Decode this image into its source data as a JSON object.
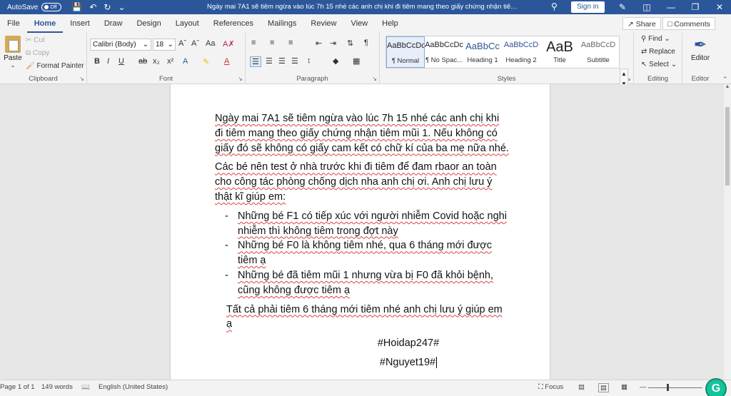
{
  "titlebar": {
    "autosave_label": "AutoSave",
    "autosave_state": "Off",
    "document_title": "Ngày mai 7A1 sẽ tiêm ngừa vào lúc 7h 15 nhé các anh chị khi đi tiêm mang theo giấy chứng nhận tiêm mũ...",
    "signin_label": "Sign in",
    "colors": {
      "bar": "#2b579a"
    }
  },
  "tabs": [
    "File",
    "Home",
    "Insert",
    "Draw",
    "Design",
    "Layout",
    "References",
    "Mailings",
    "Review",
    "View",
    "Help"
  ],
  "active_tab": "Home",
  "share_label": "Share",
  "comments_label": "Comments",
  "ribbon": {
    "clipboard": {
      "label": "Clipboard",
      "paste": "Paste",
      "cut": "Cut",
      "copy": "Copy",
      "format_painter": "Format Painter"
    },
    "font": {
      "label": "Font",
      "font_name": "Calibri (Body)",
      "font_size": "18"
    },
    "paragraph": {
      "label": "Paragraph"
    },
    "styles": {
      "label": "Styles",
      "items": [
        {
          "preview": "AaBbCcDc",
          "name": "¶ Normal"
        },
        {
          "preview": "AaBbCcDc",
          "name": "¶ No Spac..."
        },
        {
          "preview": "AaBbCc",
          "name": "Heading 1"
        },
        {
          "preview": "AaBbCcD",
          "name": "Heading 2"
        },
        {
          "preview": "AaB",
          "name": "Title"
        },
        {
          "preview": "AaBbCcD",
          "name": "Subtitle"
        }
      ]
    },
    "editing": {
      "label": "Editing",
      "find": "Find",
      "replace": "Replace",
      "select": "Select"
    },
    "editor": {
      "label": "Editor",
      "button": "Editor"
    }
  },
  "document": {
    "p1": "Ngày mai 7A1 sẽ tiêm ngừa vào lúc 7h 15 nhé các anh chị khi đi tiêm mang theo giấy chứng nhận tiêm mũi 1. Nếu không có giấy đó sẽ không có giấy cam kết có chữ kí của ba mẹ nữa nhé.",
    "p2": "Các bé nên test ở nhà trước khi đi tiêm để đam rbaor an toàn cho công tác phòng chống dịch nha anh chị ơi. Anh chị lưu ý thật kĩ giúp em:",
    "bullets": [
      "Những bé F1 có tiếp xúc với người nhiễm Covid hoặc nghi nhiễm thì không tiêm trong đợt này",
      "Những bé F0 là không tiêm nhé, qua 6 tháng mới được tiêm ạ",
      "Những bé đã tiêm mũi 1 nhưng vừa bị F0 đã khỏi bệnh, cũng không được tiêm ạ"
    ],
    "p3": "Tất cả phải tiêm 6 tháng mới tiêm nhé anh chị lưu ý giúp em ạ",
    "tag1": "#Hoidap247#",
    "tag2": "#Nguyet19#"
  },
  "statusbar": {
    "page": "Page 1 of 1",
    "words": "149 words",
    "language": "English (United States)",
    "focus": "Focus"
  }
}
